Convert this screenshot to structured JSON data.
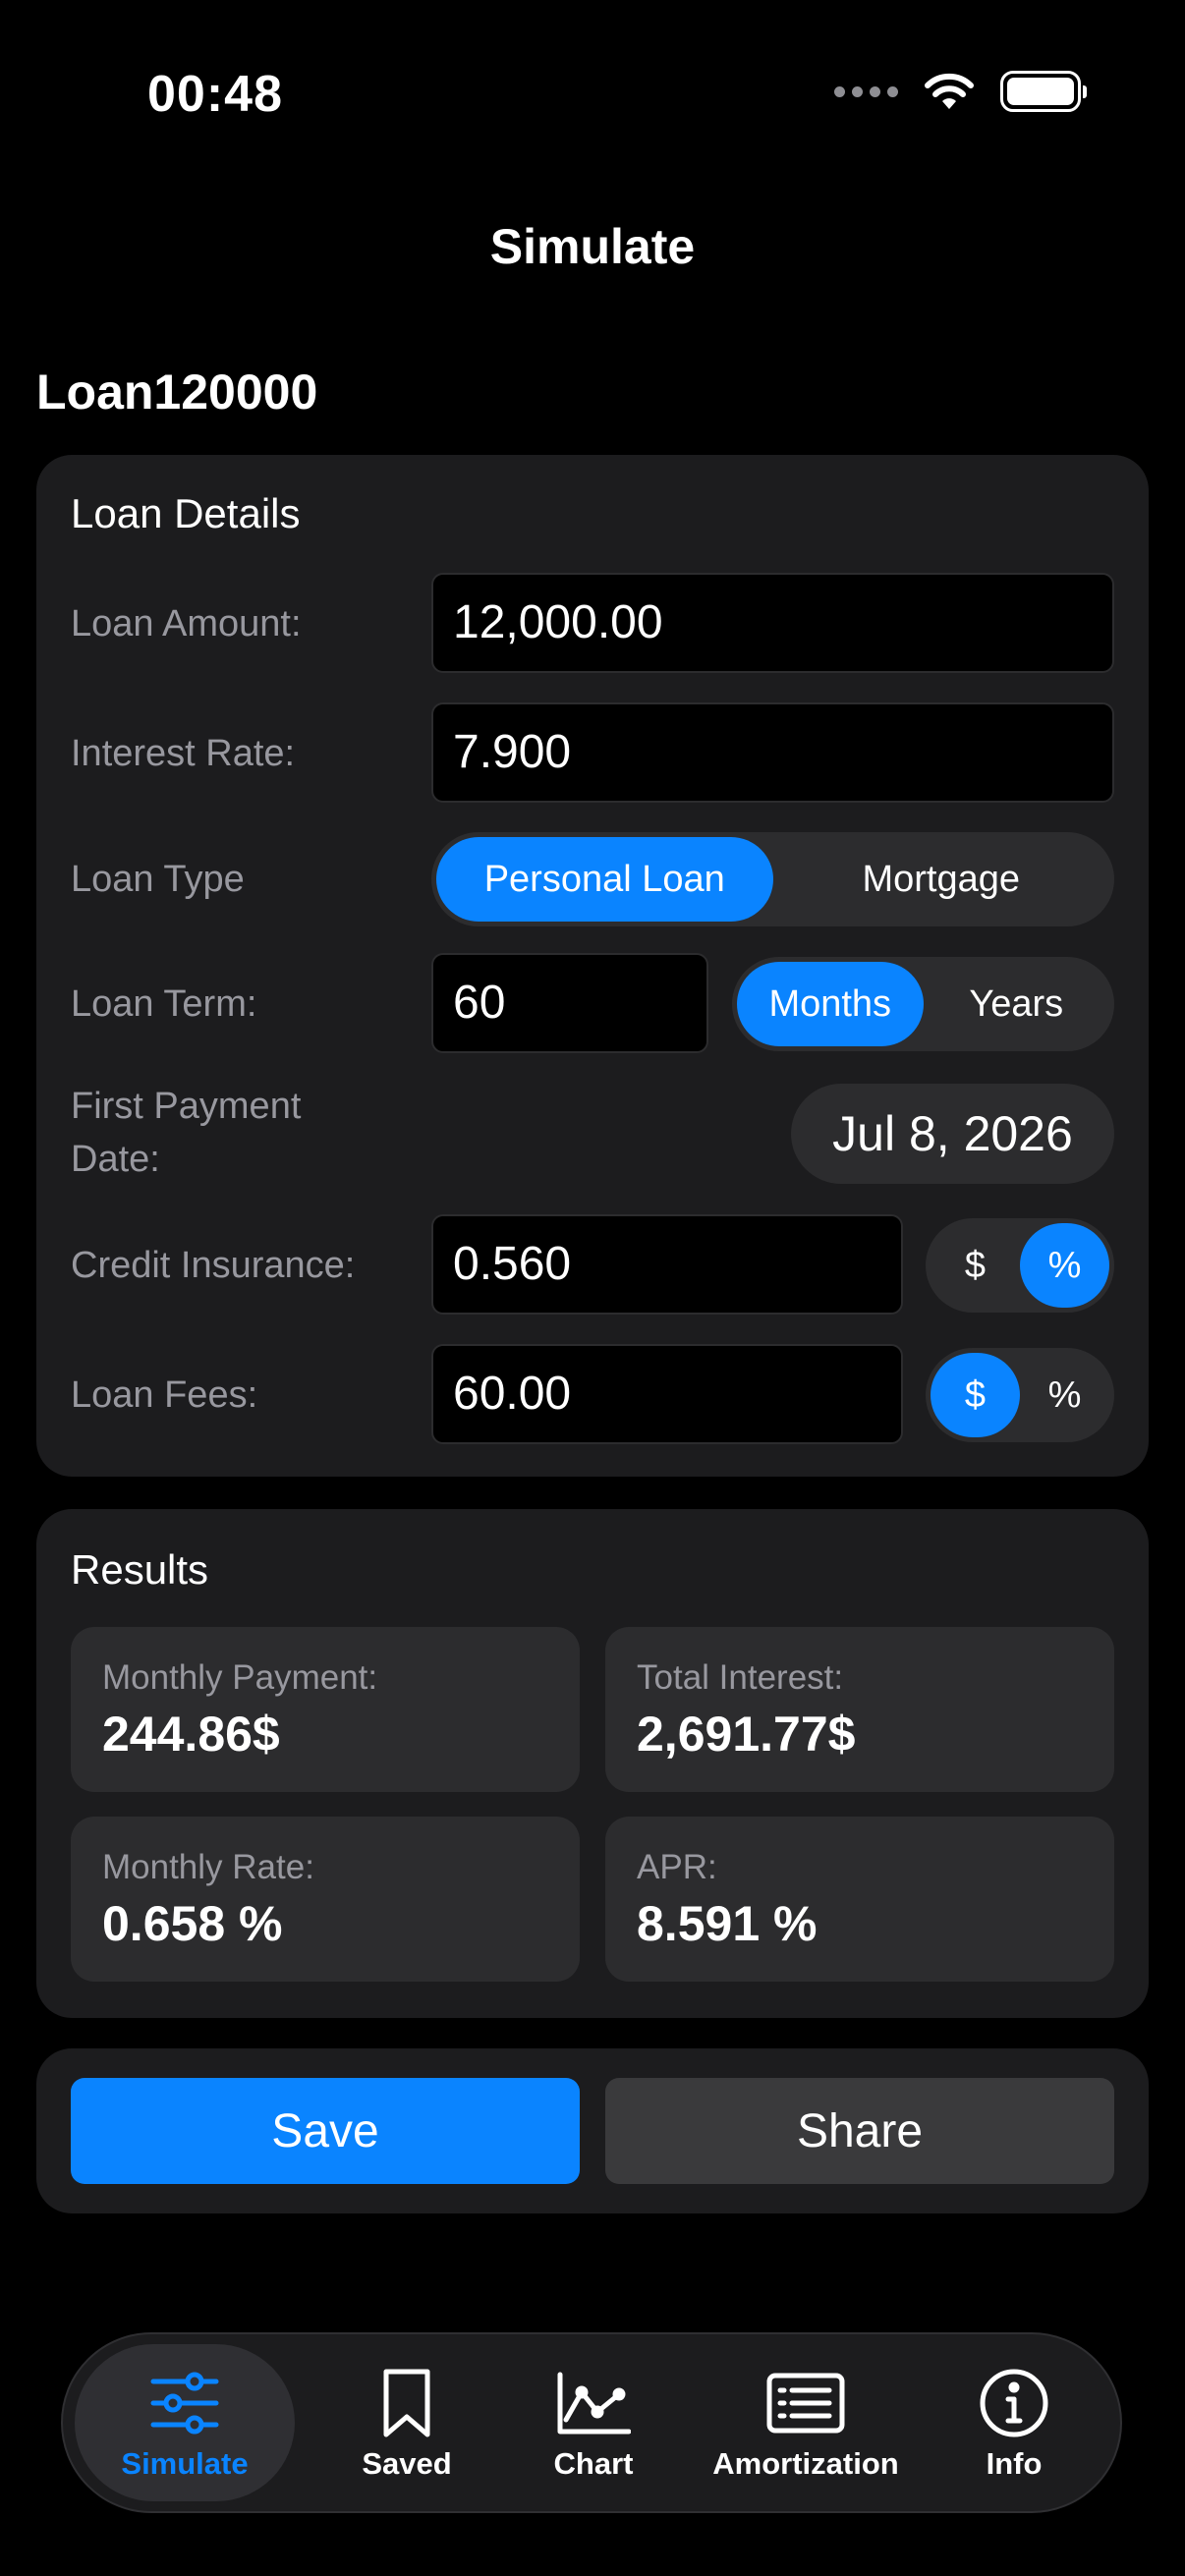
{
  "status_bar": {
    "time": "00:48"
  },
  "nav": {
    "title": "Simulate"
  },
  "simulation_name": "Loan120000",
  "loan_details": {
    "title": "Loan Details",
    "loan_amount": {
      "label": "Loan Amount:",
      "value": "12,000.00"
    },
    "interest_rate": {
      "label": "Interest Rate:",
      "value": "7.900"
    },
    "loan_type": {
      "label": "Loan Type",
      "options": [
        "Personal Loan",
        "Mortgage"
      ],
      "selected": "Personal Loan"
    },
    "loan_term": {
      "label": "Loan Term:",
      "value": "60",
      "units": [
        "Months",
        "Years"
      ],
      "selected_unit": "Months"
    },
    "first_payment": {
      "label_line1": "First Payment",
      "label_line2": "Date:",
      "value": "Jul 8, 2026"
    },
    "credit_insurance": {
      "label": "Credit Insurance:",
      "value": "0.560",
      "units": [
        "$",
        "%"
      ],
      "selected_unit": "%"
    },
    "loan_fees": {
      "label": "Loan Fees:",
      "value": "60.00",
      "units": [
        "$",
        "%"
      ],
      "selected_unit": "$"
    }
  },
  "results": {
    "title": "Results",
    "monthly_payment": {
      "label": "Monthly Payment:",
      "value": "244.86$"
    },
    "total_interest": {
      "label": "Total Interest:",
      "value": "2,691.77$"
    },
    "monthly_rate": {
      "label": "Monthly Rate:",
      "value": "0.658 %"
    },
    "apr": {
      "label": "APR:",
      "value": "8.591 %"
    }
  },
  "actions": {
    "save_label": "Save",
    "share_label": "Share"
  },
  "tabbar": {
    "items": [
      {
        "label": "Simulate",
        "icon": "sliders-icon",
        "active": true
      },
      {
        "label": "Saved",
        "icon": "bookmark-icon"
      },
      {
        "label": "Chart",
        "icon": "line-chart-icon"
      },
      {
        "label": "Amortization",
        "icon": "list-table-icon"
      },
      {
        "label": "Info",
        "icon": "info-icon"
      }
    ]
  },
  "colors": {
    "accent": "#0a84ff",
    "card": "#1c1c1e",
    "control": "#2c2c2e",
    "secondary_text": "#98989f"
  }
}
